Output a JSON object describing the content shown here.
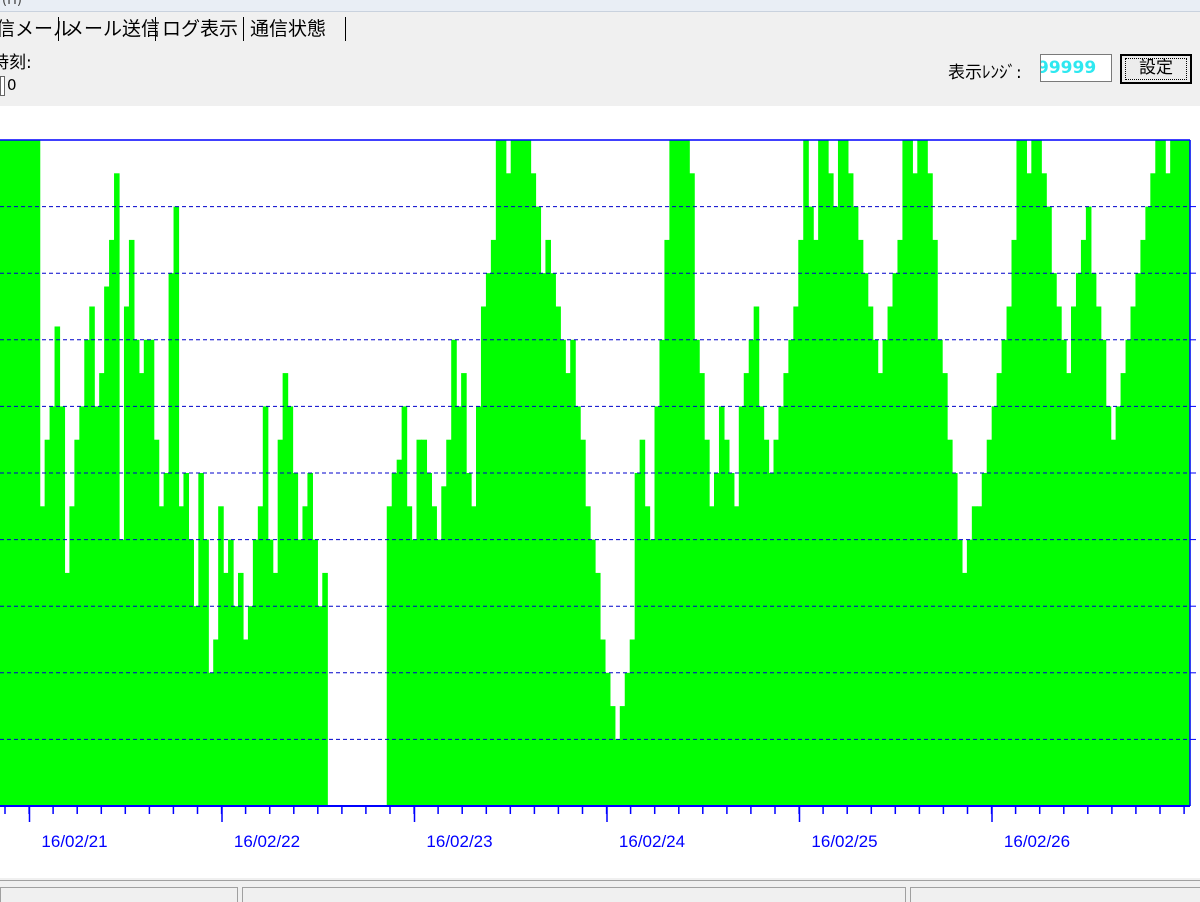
{
  "window": {
    "title_fragment": "(H)"
  },
  "menu": {
    "items": [
      {
        "label": "信メール",
        "name": "menu-received-mail"
      },
      {
        "label": "メール送信",
        "name": "menu-send-mail"
      },
      {
        "label": "ログ表示",
        "name": "menu-log-view"
      },
      {
        "label": "通信状態",
        "name": "menu-connection-status"
      }
    ]
  },
  "toolbar": {
    "time_label": "時刻:",
    "time_value": "0",
    "range_label": "表示ﾚﾝｼﾞ:",
    "range_value": "99999",
    "set_button_label": "設定"
  },
  "colors": {
    "received": "#00ff00",
    "error": "#ff0000",
    "axis": "#0000ff",
    "grid": "#0000cc"
  },
  "chart_data": {
    "type": "area",
    "x_tick_labels": [
      "16/02/21",
      "16/02/22",
      "16/02/23",
      "16/02/24",
      "16/02/25",
      "16/02/26"
    ],
    "grid": true,
    "gridline_count": 10,
    "series": [
      {
        "color": "#00ff00",
        "values": [
          100,
          100,
          100,
          100,
          100,
          100,
          100,
          100,
          45,
          55,
          60,
          72,
          60,
          35,
          45,
          55,
          60,
          70,
          75,
          60,
          65,
          78,
          85,
          95,
          40,
          75,
          85,
          70,
          65,
          70,
          70,
          55,
          45,
          50,
          80,
          90,
          45,
          50,
          40,
          30,
          50,
          40,
          20,
          25,
          45,
          35,
          40,
          30,
          35,
          25,
          30,
          40,
          45,
          60,
          40,
          35,
          55,
          65,
          60,
          50,
          40,
          45,
          50,
          40,
          30,
          35,
          0,
          0,
          0,
          0,
          0,
          0,
          0,
          0,
          0,
          0,
          0,
          0,
          45,
          50,
          52,
          60,
          45,
          40,
          55,
          55,
          50,
          45,
          40,
          48,
          55,
          70,
          60,
          65,
          50,
          45,
          60,
          75,
          80,
          85,
          100,
          100,
          95,
          100,
          100,
          100,
          100,
          95,
          90,
          80,
          85,
          80,
          75,
          70,
          65,
          70,
          60,
          55,
          45,
          40,
          35,
          25,
          20,
          15,
          10,
          15,
          20,
          25,
          50,
          55,
          45,
          40,
          60,
          70,
          85,
          100,
          100,
          100,
          100,
          95,
          70,
          65,
          55,
          45,
          50,
          60,
          55,
          50,
          45,
          60,
          65,
          70,
          75,
          60,
          55,
          50,
          55,
          60,
          65,
          70,
          75,
          85,
          100,
          90,
          85,
          100,
          100,
          95,
          90,
          100,
          100,
          95,
          90,
          85,
          80,
          75,
          70,
          65,
          70,
          75,
          80,
          85,
          100,
          100,
          95,
          100,
          100,
          95,
          85,
          70,
          65,
          55,
          50,
          40,
          35,
          40,
          45,
          45,
          50,
          55,
          60,
          65,
          70,
          75,
          85,
          100,
          100,
          95,
          100,
          100,
          95,
          90,
          80,
          75,
          70,
          65,
          75,
          80,
          85,
          90,
          80,
          75,
          70,
          60,
          55,
          60,
          65,
          70,
          75,
          80,
          85,
          90,
          95,
          100,
          100,
          95,
          100,
          100,
          100,
          100
        ]
      },
      {
        "color": "#ff0000",
        "values": [
          0,
          0,
          0,
          0,
          0,
          0,
          0,
          0,
          0,
          0,
          0,
          0,
          0,
          0,
          0,
          0,
          0,
          0,
          0,
          0,
          0,
          0,
          0,
          0,
          0,
          0,
          0,
          0,
          0,
          0,
          0,
          0,
          0,
          0,
          0,
          0,
          0,
          0,
          0,
          0,
          0,
          0,
          0,
          0,
          0,
          0,
          0,
          0,
          0,
          0,
          0,
          0,
          0,
          0,
          0,
          0,
          0,
          0,
          0,
          0,
          0,
          0,
          0,
          0,
          0,
          0,
          0,
          0,
          0,
          0,
          0,
          0,
          0,
          0,
          0,
          0,
          0,
          0,
          0,
          0,
          0,
          0,
          0,
          0,
          0,
          0,
          0,
          0,
          0,
          0,
          0,
          0,
          0,
          0,
          0,
          0,
          0,
          0,
          0,
          0,
          0,
          0,
          0,
          0,
          0,
          0,
          0,
          0,
          0,
          0,
          0,
          0,
          0,
          0,
          0,
          0,
          0,
          0,
          0,
          0,
          0,
          0,
          0,
          0,
          0,
          0,
          0,
          0,
          0,
          0,
          0,
          0,
          0,
          0,
          0,
          0,
          0,
          0,
          0,
          0,
          0,
          0,
          0,
          0,
          0,
          0,
          0,
          0,
          0,
          0,
          0,
          0,
          0,
          0,
          0,
          0,
          0,
          0,
          0,
          0,
          0,
          0,
          0,
          0,
          0,
          0,
          0,
          0,
          0,
          0,
          0,
          0,
          0,
          0,
          0,
          0,
          0,
          0,
          0,
          0,
          0,
          0,
          0,
          0,
          0,
          0,
          0,
          0,
          0,
          0,
          0,
          0,
          0,
          0,
          0,
          0,
          0,
          0,
          0,
          0,
          0,
          0,
          0,
          0,
          0,
          0,
          0,
          0,
          0,
          0,
          0,
          0,
          0,
          0,
          0,
          0,
          0,
          0,
          0,
          0,
          0,
          0,
          0,
          0,
          0,
          0,
          0,
          0,
          0,
          0,
          0,
          0,
          0,
          0,
          0,
          0,
          0,
          0,
          0,
          0
        ]
      }
    ]
  }
}
